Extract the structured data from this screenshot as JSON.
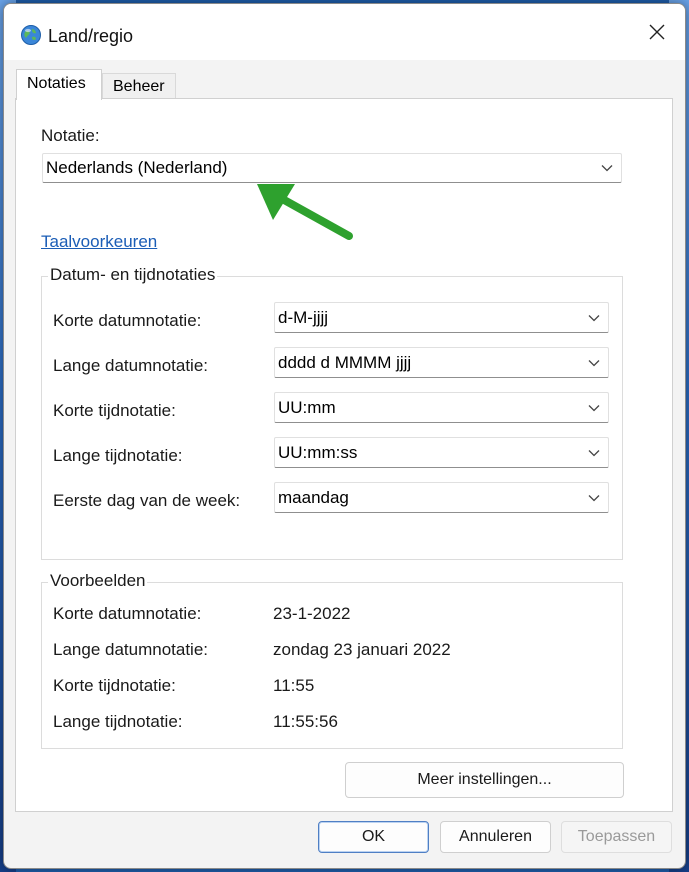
{
  "window": {
    "title": "Land/regio"
  },
  "tabs": [
    {
      "label": "Notaties",
      "active": true
    },
    {
      "label": "Beheer",
      "active": false
    }
  ],
  "format": {
    "label": "Notatie:",
    "value": "Nederlands (Nederland)"
  },
  "language_link": "Taalvoorkeuren",
  "datetime_group": {
    "title": "Datum- en tijdnotaties",
    "rows": [
      {
        "label": "Korte datumnotatie:",
        "value": "d-M-jjjj"
      },
      {
        "label": "Lange datumnotatie:",
        "value": "dddd d MMMM jjjj"
      },
      {
        "label": "Korte tijdnotatie:",
        "value": "UU:mm"
      },
      {
        "label": "Lange tijdnotatie:",
        "value": "UU:mm:ss"
      },
      {
        "label": "Eerste dag van de week:",
        "value": "maandag"
      }
    ]
  },
  "examples_group": {
    "title": "Voorbeelden",
    "rows": [
      {
        "label": "Korte datumnotatie:",
        "value": "23-1-2022"
      },
      {
        "label": "Lange datumnotatie:",
        "value": "zondag 23 januari 2022"
      },
      {
        "label": "Korte tijdnotatie:",
        "value": "11:55"
      },
      {
        "label": "Lange tijdnotatie:",
        "value": "11:55:56"
      }
    ]
  },
  "buttons": {
    "more_settings": "Meer instellingen...",
    "ok": "OK",
    "cancel": "Annuleren",
    "apply": "Toepassen"
  },
  "colors": {
    "accent": "#1b5db6",
    "annotation_arrow": "#2ea12e"
  },
  "icons": {
    "app": "globe-icon",
    "close": "close-icon",
    "dropdown": "chevron-down-icon"
  }
}
